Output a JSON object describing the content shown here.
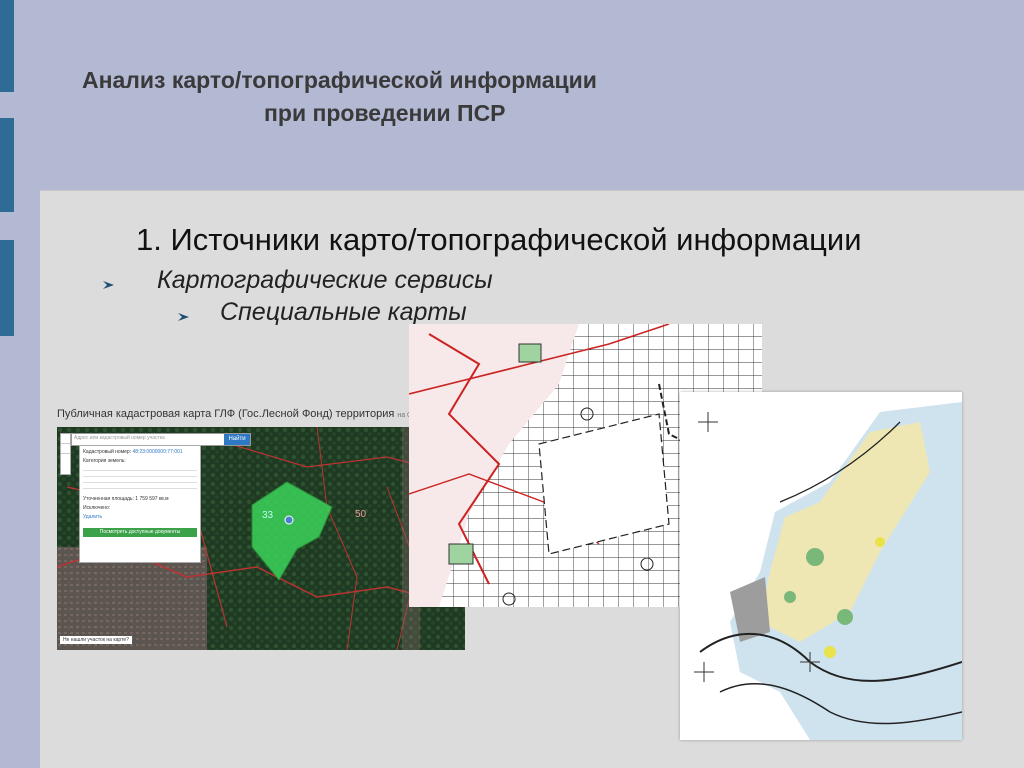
{
  "slide": {
    "title_line1": "Анализ карто/топографической информации",
    "title_line2": "при проведении ПСР",
    "heading": "1. Источники карто/топографической информации",
    "bullets": [
      "Картографические сервисы",
      "Специальные карты"
    ]
  },
  "cadastral_map": {
    "caption": "Публичная кадастровая карта ГЛФ (Гос.Лесной Фонд) территория",
    "caption_date": "на 01.10.2018",
    "search_placeholder": "Адрес или кадастровый номер участка",
    "search_button": "Найти",
    "info_title": "Кадастровый номер:",
    "info_number": "48:23:0000000:77:001",
    "info_category_label": "Категория земель:",
    "info_area_label": "Уточненная площадь:",
    "info_area": "1 759 597 кв.м",
    "info_owner_label": "Исключено:",
    "info_delete": "Удалить",
    "info_button": "Посмотреть доступные документы",
    "parcel_label_1": "33",
    "parcel_label_2": "50",
    "feedback_link": "Не нашли участок на карте?"
  },
  "colors": {
    "background": "#b3b8d3",
    "accent": "#2e6b95",
    "panel": "#dcdcdc",
    "parcel_green": "#3cd35a"
  }
}
